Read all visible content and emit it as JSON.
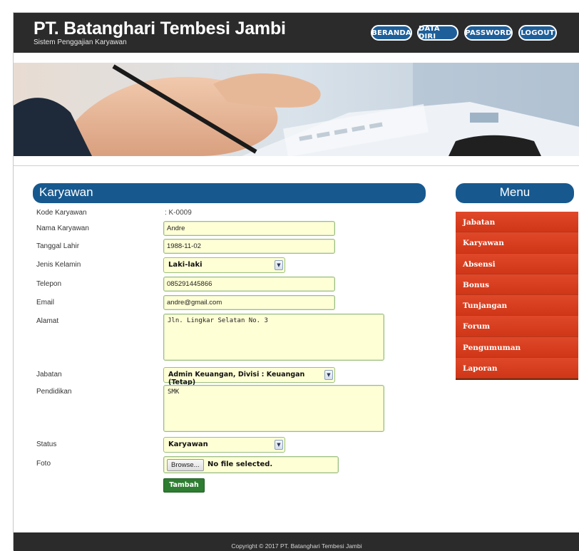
{
  "header": {
    "title": "PT. Batanghari Tembesi Jambi",
    "subtitle": "Sistem Penggajian Karyawan",
    "nav": [
      "BERANDA",
      "DATA DIRI",
      "PASSWORD",
      "LOGOUT"
    ]
  },
  "section": {
    "title": "Karyawan"
  },
  "form": {
    "kode_label": "Kode Karyawan",
    "kode_value": ": K-0009",
    "nama_label": "Nama Karyawan",
    "nama_value": "Andre",
    "tgl_label": "Tanggal Lahir",
    "tgl_value": "1988-11-02",
    "jk_label": "Jenis Kelamin",
    "jk_value": "Laki-laki",
    "telp_label": "Telepon",
    "telp_value": "085291445866",
    "email_label": "Email",
    "email_value": "andre@gmail.com",
    "alamat_label": "Alamat",
    "alamat_value": "Jln. Lingkar Selatan No. 3",
    "jabatan_label": "Jabatan",
    "jabatan_value": "Admin Keuangan, Divisi : Keuangan (Tetap)",
    "pendidikan_label": "Pendidikan",
    "pendidikan_value": "SMK",
    "status_label": "Status",
    "status_value": "Karyawan",
    "foto_label": "Foto",
    "browse_label": "Browse...",
    "file_status": "No file selected.",
    "submit_label": "Tambah"
  },
  "menu": {
    "title": "Menu",
    "items": [
      "Jabatan",
      "Karyawan",
      "Absensi",
      "Bonus",
      "Tunjangan",
      "Forum",
      "Pengumuman",
      "Laporan"
    ]
  },
  "footer": {
    "text": "Copyright © 2017 PT. Batanghari Tembesi Jambi"
  },
  "colors": {
    "header_bg": "#2b2b2b",
    "section_bar": "#17598f",
    "menu_item": "#d63b1c",
    "input_bg": "#ffffd6",
    "submit_bg": "#2e7d32"
  }
}
